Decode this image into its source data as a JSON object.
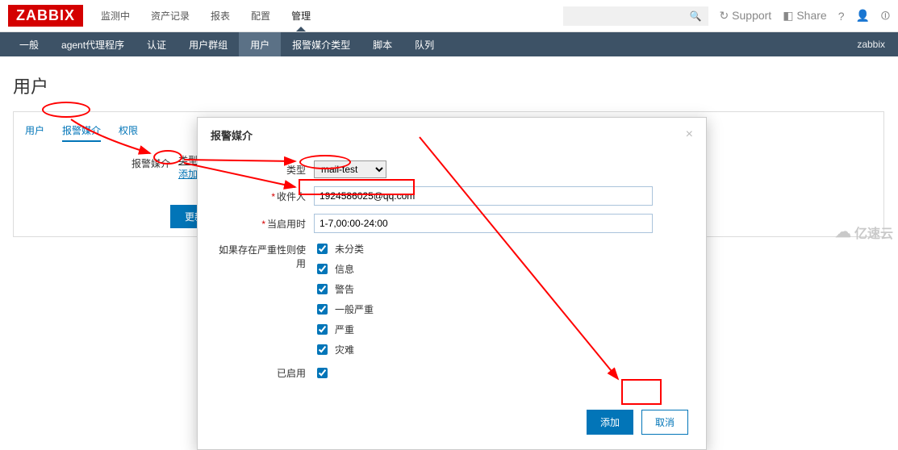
{
  "header": {
    "logo": "ZABBIX",
    "nav": [
      "监测中",
      "资产记录",
      "报表",
      "配置",
      "管理"
    ],
    "nav_active_index": 4,
    "support": "Support",
    "share": "Share",
    "help_icon": "?",
    "user_icon": "user-icon",
    "logout_icon": "power-icon",
    "search_icon": "search-icon"
  },
  "subnav": {
    "items": [
      "一般",
      "agent代理程序",
      "认证",
      "用户群组",
      "用户",
      "报警媒介类型",
      "脚本",
      "队列"
    ],
    "active_index": 4,
    "right": "zabbix"
  },
  "page": {
    "title": "用户",
    "tabs": [
      "用户",
      "报警媒介",
      "权限"
    ],
    "active_tab_index": 1,
    "media_label": "报警媒介",
    "media_type_header": "类型",
    "add_link": "添加",
    "update_btn": "更新"
  },
  "modal": {
    "title": "报警媒介",
    "type_label": "类型",
    "type_value": "mail-test",
    "sendto_label": "收件人",
    "sendto_value": "1924586025@qq.com",
    "when_label": "当启用时",
    "when_value": "1-7,00:00-24:00",
    "severity_label": "如果存在严重性则使用",
    "severities": [
      "未分类",
      "信息",
      "警告",
      "一般严重",
      "严重",
      "灾难"
    ],
    "enabled_label": "已启用",
    "btn_add": "添加",
    "btn_cancel": "取消"
  },
  "watermark": "亿速云"
}
